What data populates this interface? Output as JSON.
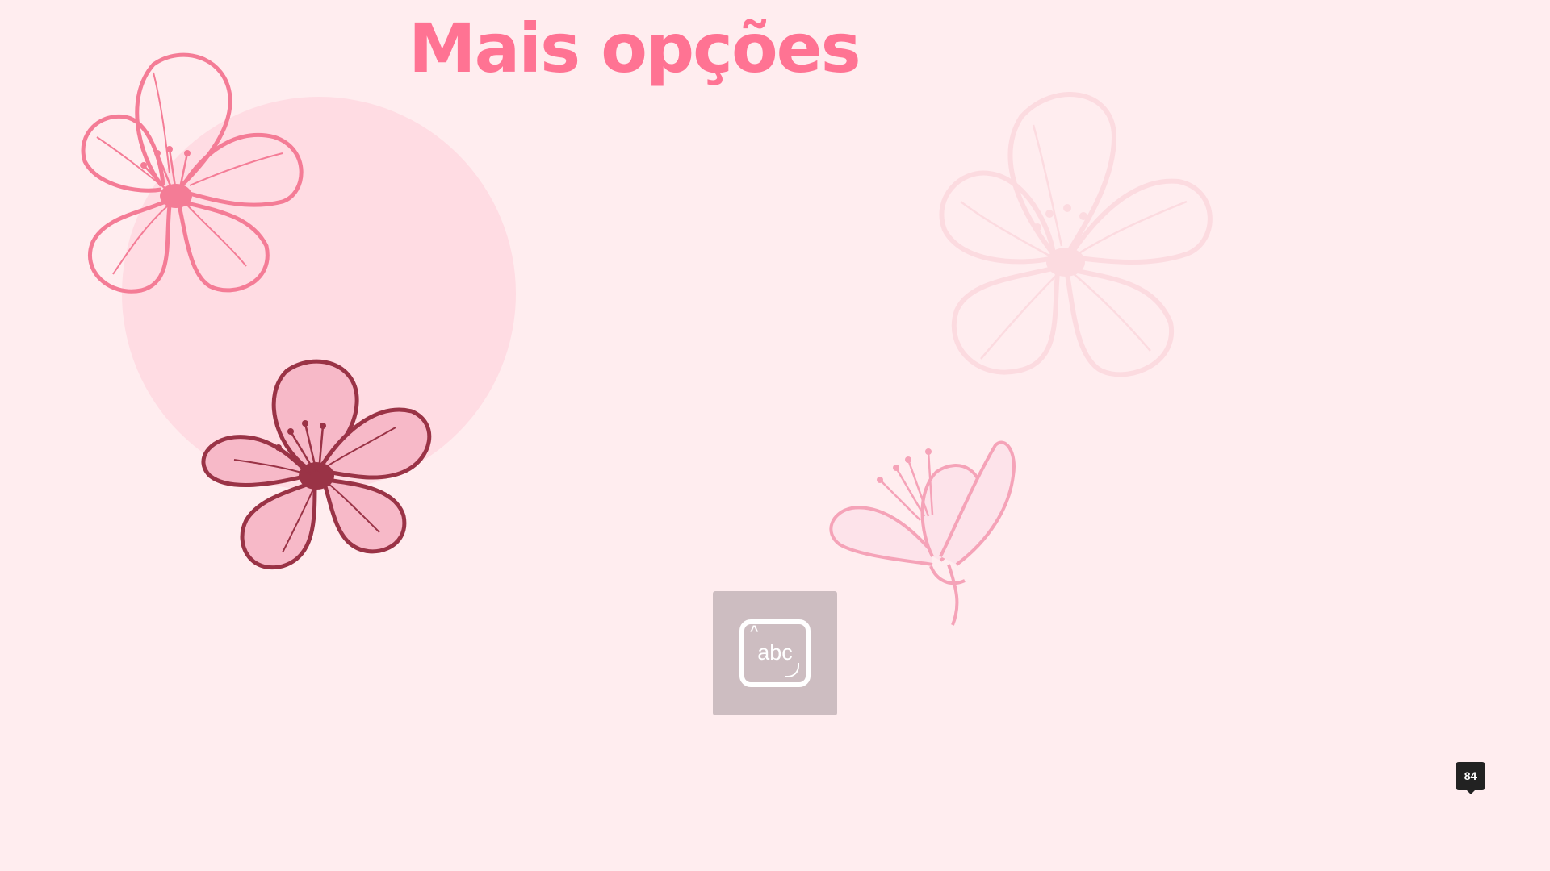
{
  "slide": {
    "title": "Mais opções",
    "page_number": "84"
  },
  "image_placeholder": {
    "icon": "text-box-icon",
    "icon_text": "abc"
  },
  "decorations": [
    {
      "name": "cherry-blossom-outline-icon",
      "description": "outline pink flower"
    },
    {
      "name": "cherry-blossom-faded-icon",
      "description": "faded pink flower"
    },
    {
      "name": "cherry-blossom-filled-icon",
      "description": "filled pink flower"
    },
    {
      "name": "cherry-blossom-bud-icon",
      "description": "side-view flower bud"
    }
  ],
  "colors": {
    "background": "#FFEDEF",
    "title": "#FF7393",
    "circle": "#FFDCE3",
    "outline_flower": "#F47C96",
    "faded_flower": "#F9C6D0",
    "filled_flower_fill": "#F7B9C8",
    "filled_flower_stroke": "#9A3346",
    "bud": "#F5A3B8",
    "placeholder_bg": "#CDBDC1",
    "badge_bg": "#222222"
  }
}
